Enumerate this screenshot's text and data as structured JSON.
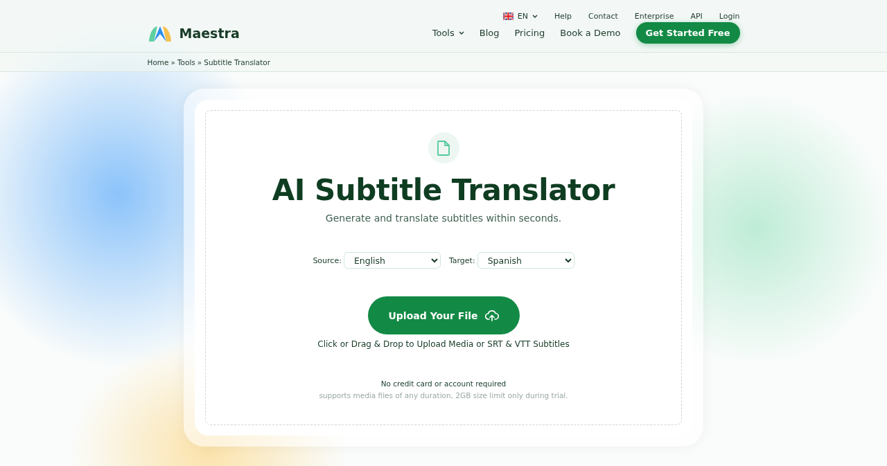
{
  "header": {
    "brand": "Maestra",
    "top_links": [
      {
        "label": "EN",
        "kind": "language"
      },
      {
        "label": "Help",
        "kind": "link"
      },
      {
        "label": "Contact",
        "kind": "link"
      },
      {
        "label": "Enterprise",
        "kind": "link"
      },
      {
        "label": "API",
        "kind": "link"
      },
      {
        "label": "Login",
        "kind": "link"
      }
    ],
    "nav": [
      {
        "label": "Tools",
        "kind": "dropdown"
      },
      {
        "label": "Blog",
        "kind": "link"
      },
      {
        "label": "Pricing",
        "kind": "link"
      },
      {
        "label": "Book a Demo",
        "kind": "link"
      }
    ],
    "cta": "Get Started Free"
  },
  "breadcrumb": {
    "separator": "»",
    "items": [
      "Home",
      "Tools",
      "Subtitle Translator"
    ]
  },
  "tool": {
    "title": "AI Subtitle Translator",
    "subtitle": "Generate and translate subtitles within seconds.",
    "source": {
      "label": "Source:",
      "value": "English"
    },
    "target": {
      "label": "Target:",
      "value": "Spanish"
    },
    "upload_button": "Upload Your File",
    "hint": "Click or Drag & Drop to Upload Media or SRT & VTT Subtitles",
    "note": "No credit card or account required",
    "fine_print": "supports media files of any duration, 2GB size limit only during trial."
  }
}
